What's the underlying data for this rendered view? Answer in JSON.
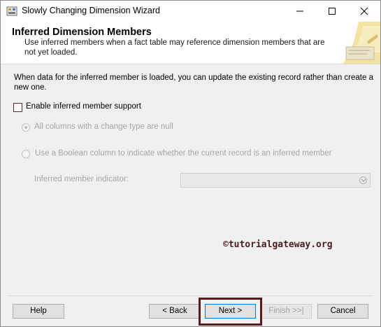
{
  "window": {
    "title": "Slowly Changing Dimension Wizard"
  },
  "header": {
    "title": "Inferred Dimension Members",
    "subtitle": "Use inferred members when a fact table may reference dimension members that are not yet loaded."
  },
  "body": {
    "description": "When data for the inferred member is loaded, you can update the existing record rather than create a new one.",
    "enable_checkbox": {
      "label": "Enable inferred member support",
      "checked": false
    },
    "radio_null": {
      "label": "All columns with a change type are null",
      "selected": true,
      "enabled": false
    },
    "radio_boolean": {
      "label": "Use a Boolean column to indicate whether the current record is an inferred member",
      "selected": false,
      "enabled": false
    },
    "indicator": {
      "label": "Inferred member indicator:",
      "value": ""
    }
  },
  "watermark": "©tutorialgateway.org",
  "footer": {
    "help": "Help",
    "back": "< Back",
    "next": "Next >",
    "finish": "Finish >>|",
    "cancel": "Cancel"
  },
  "colors": {
    "highlight": "#5b1a1a",
    "watermark": "#4d1d1d",
    "focus": "#0078d7"
  }
}
